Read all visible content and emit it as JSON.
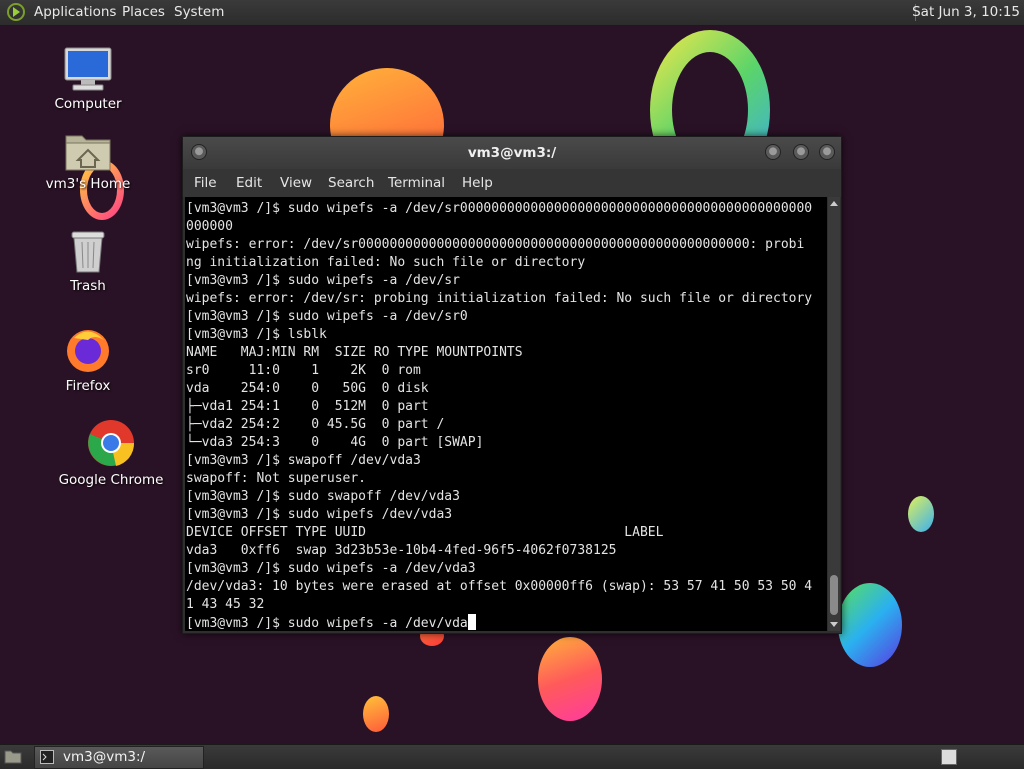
{
  "top_panel": {
    "menu": [
      "Applications",
      "Places",
      "System"
    ],
    "clock": "Sat Jun  3, 10:15"
  },
  "desktop_icons": [
    {
      "label": "Computer",
      "icon": "computer-icon"
    },
    {
      "label": "vm3's Home",
      "icon": "home-folder-icon"
    },
    {
      "label": "Trash",
      "icon": "trash-icon"
    },
    {
      "label": "Firefox",
      "icon": "firefox-icon"
    },
    {
      "label": "Google Chrome",
      "icon": "chrome-icon"
    }
  ],
  "terminal": {
    "title": "vm3@vm3:/",
    "menu": [
      "File",
      "Edit",
      "View",
      "Search",
      "Terminal",
      "Help"
    ],
    "lines": [
      "[vm3@vm3 /]$ sudo wipefs -a /dev/sr000000000000000000000000000000000000000000000",
      "000000",
      "wipefs: error: /dev/sr00000000000000000000000000000000000000000000000000: probi",
      "ng initialization failed: No such file or directory",
      "[vm3@vm3 /]$ sudo wipefs -a /dev/sr",
      "wipefs: error: /dev/sr: probing initialization failed: No such file or directory",
      "[vm3@vm3 /]$ sudo wipefs -a /dev/sr0",
      "[vm3@vm3 /]$ lsblk",
      "NAME   MAJ:MIN RM  SIZE RO TYPE MOUNTPOINTS",
      "sr0     11:0    1    2K  0 rom",
      "vda    254:0    0   50G  0 disk",
      "├─vda1 254:1    0  512M  0 part",
      "├─vda2 254:2    0 45.5G  0 part /",
      "└─vda3 254:3    0    4G  0 part [SWAP]",
      "[vm3@vm3 /]$ swapoff /dev/vda3",
      "swapoff: Not superuser.",
      "[vm3@vm3 /]$ sudo swapoff /dev/vda3",
      "[vm3@vm3 /]$ sudo wipefs /dev/vda3",
      "DEVICE OFFSET TYPE UUID                                 LABEL",
      "vda3   0xff6  swap 3d23b53e-10b4-4fed-96f5-4062f0738125",
      "[vm3@vm3 /]$ sudo wipefs -a /dev/vda3",
      "/dev/vda3: 10 bytes were erased at offset 0x00000ff6 (swap): 53 57 41 50 53 50 4",
      "1 43 45 32"
    ],
    "prompt_line": "[vm3@vm3 /]$ sudo wipefs -a /dev/vda"
  },
  "taskbar": {
    "window_label": "vm3@vm3:/"
  }
}
